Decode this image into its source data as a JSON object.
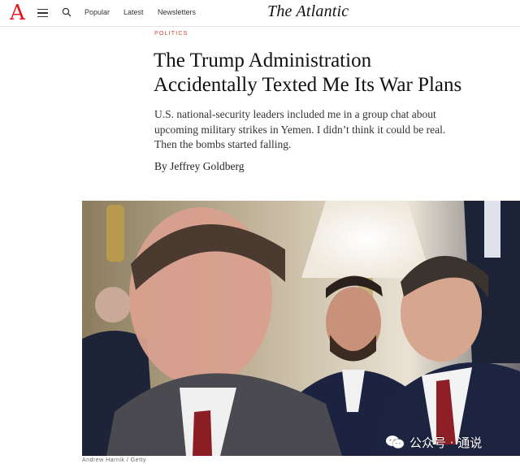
{
  "header": {
    "logo_letter": "A",
    "nav": [
      "Popular",
      "Latest",
      "Newsletters"
    ],
    "brand": "The Atlantic"
  },
  "article": {
    "section": "POLITICS",
    "headline_line1": "The Trump Administration",
    "headline_line2": "Accidentally Texted Me Its War Plans",
    "dek_line1": "U.S. national-security leaders included me in a group chat about",
    "dek_line2": "upcoming military strikes in Yemen. I didn’t think it could be real.",
    "dek_line3": "Then the bombs started falling.",
    "byline": "By Jeffrey Goldberg",
    "photo_credit": "Andrew Harnik / Getty"
  },
  "watermark": {
    "text": "公众号 · 通说",
    "icon": "wechat-icon"
  },
  "colors": {
    "logo_red": "#e7131a",
    "kicker_red": "#d6422f"
  }
}
